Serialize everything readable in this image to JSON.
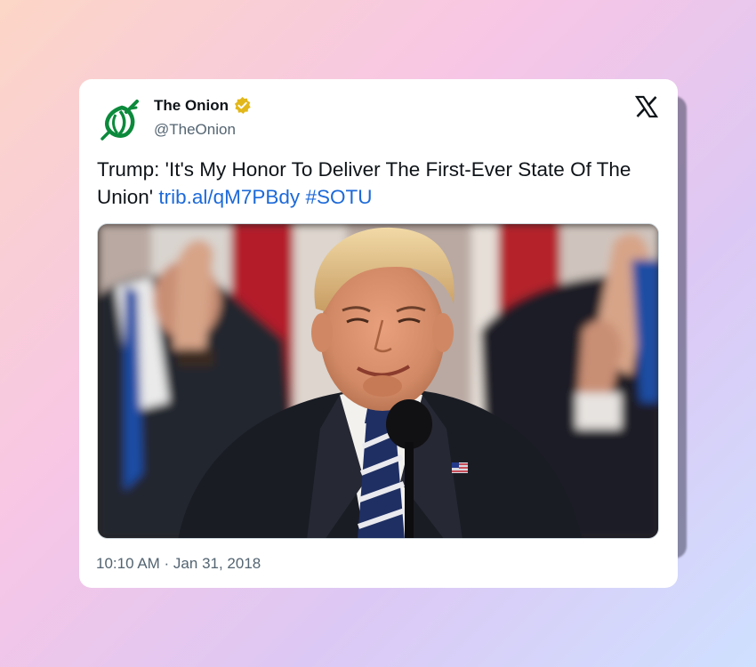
{
  "tweet": {
    "author": {
      "display_name": "The Onion",
      "handle": "@TheOnion",
      "verified": true,
      "avatar_icon": "onion-logo"
    },
    "text": "Trump: 'It's My Honor To Deliver The First-Ever State Of The Union'",
    "link": "trib.al/qM7PBdy",
    "hashtag": "#SOTU",
    "timestamp": "10:10 AM · Jan 31, 2018",
    "platform_icon": "x-logo"
  },
  "colors": {
    "link": "#1d6ad9",
    "text": "#0f1419",
    "muted": "#536471",
    "verified_badge": "#e2b719",
    "onion_green": "#0c8a3c"
  }
}
